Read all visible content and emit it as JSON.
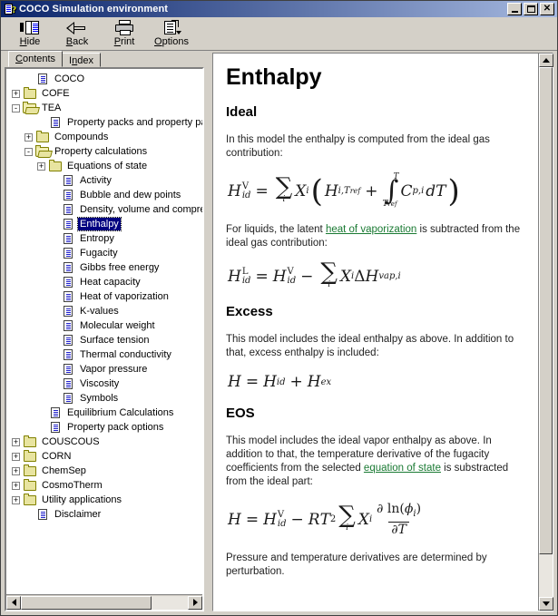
{
  "window": {
    "title": "COCO Simulation environment",
    "icon": "help-book-icon",
    "minimize_label": "_",
    "maximize_label": "□",
    "close_label": "✕"
  },
  "toolbar": {
    "items": [
      {
        "label": "Hide",
        "icon": "hide-pane-icon",
        "accel": "H"
      },
      {
        "label": "Back",
        "icon": "back-arrow-icon",
        "accel": "B"
      },
      {
        "label": "Print",
        "icon": "printer-icon",
        "accel": "P"
      },
      {
        "label": "Options",
        "icon": "options-icon",
        "accel": "O"
      }
    ]
  },
  "tabs": [
    {
      "label": "Contents",
      "accel": "C",
      "active": true
    },
    {
      "label": "Index",
      "accel": "n",
      "active": false
    }
  ],
  "tree": {
    "nodes": [
      {
        "label": "COCO",
        "indent": 1,
        "icon": "topic-page-icon",
        "expander": ""
      },
      {
        "label": "COFE",
        "indent": 0,
        "icon": "folder-closed-icon",
        "expander": "+"
      },
      {
        "label": "TEA",
        "indent": 0,
        "icon": "folder-open-icon",
        "expander": "-"
      },
      {
        "label": "Property packs and property pack i",
        "indent": 2,
        "icon": "topic-page-icon",
        "expander": ""
      },
      {
        "label": "Compounds",
        "indent": 1,
        "icon": "folder-closed-icon",
        "expander": "+"
      },
      {
        "label": "Property calculations",
        "indent": 1,
        "icon": "folder-open-icon",
        "expander": "-"
      },
      {
        "label": "Equations of state",
        "indent": 2,
        "icon": "folder-closed-icon",
        "expander": "+"
      },
      {
        "label": "Activity",
        "indent": 3,
        "icon": "topic-page-icon",
        "expander": ""
      },
      {
        "label": "Bubble and dew points",
        "indent": 3,
        "icon": "topic-page-icon",
        "expander": ""
      },
      {
        "label": "Density, volume and compressi",
        "indent": 3,
        "icon": "topic-page-icon",
        "expander": ""
      },
      {
        "label": "Enthalpy",
        "indent": 3,
        "icon": "topic-page-icon",
        "expander": "",
        "selected": true
      },
      {
        "label": "Entropy",
        "indent": 3,
        "icon": "topic-page-icon",
        "expander": ""
      },
      {
        "label": "Fugacity",
        "indent": 3,
        "icon": "topic-page-icon",
        "expander": ""
      },
      {
        "label": "Gibbs free energy",
        "indent": 3,
        "icon": "topic-page-icon",
        "expander": ""
      },
      {
        "label": "Heat capacity",
        "indent": 3,
        "icon": "topic-page-icon",
        "expander": ""
      },
      {
        "label": "Heat of vaporization",
        "indent": 3,
        "icon": "topic-page-icon",
        "expander": ""
      },
      {
        "label": "K-values",
        "indent": 3,
        "icon": "topic-page-icon",
        "expander": ""
      },
      {
        "label": "Molecular weight",
        "indent": 3,
        "icon": "topic-page-icon",
        "expander": ""
      },
      {
        "label": "Surface tension",
        "indent": 3,
        "icon": "topic-page-icon",
        "expander": ""
      },
      {
        "label": "Thermal conductivity",
        "indent": 3,
        "icon": "topic-page-icon",
        "expander": ""
      },
      {
        "label": "Vapor pressure",
        "indent": 3,
        "icon": "topic-page-icon",
        "expander": ""
      },
      {
        "label": "Viscosity",
        "indent": 3,
        "icon": "topic-page-icon",
        "expander": ""
      },
      {
        "label": "Symbols",
        "indent": 3,
        "icon": "topic-page-icon",
        "expander": ""
      },
      {
        "label": "Equilibrium Calculations",
        "indent": 2,
        "icon": "topic-page-icon",
        "expander": ""
      },
      {
        "label": "Property pack options",
        "indent": 2,
        "icon": "topic-page-icon",
        "expander": ""
      },
      {
        "label": "COUSCOUS",
        "indent": 0,
        "icon": "folder-closed-icon",
        "expander": "+"
      },
      {
        "label": "CORN",
        "indent": 0,
        "icon": "folder-closed-icon",
        "expander": "+"
      },
      {
        "label": "ChemSep",
        "indent": 0,
        "icon": "folder-closed-icon",
        "expander": "+"
      },
      {
        "label": "CosmoTherm",
        "indent": 0,
        "icon": "folder-closed-icon",
        "expander": "+"
      },
      {
        "label": "Utility applications",
        "indent": 0,
        "icon": "folder-closed-icon",
        "expander": "+"
      },
      {
        "label": "Disclaimer",
        "indent": 1,
        "icon": "topic-page-icon",
        "expander": ""
      }
    ]
  },
  "document": {
    "title": "Enthalpy",
    "sections": [
      {
        "heading": "Ideal",
        "para1_a": "In this model the enthalpy is computed from the ideal gas contribution:",
        "para2_a": "For liquids, the latent ",
        "para2_link": "heat of vaporization",
        "para2_b": " is subtracted from the ideal gas contribution:"
      },
      {
        "heading": "Excess",
        "para_a": "This model includes the ideal enthalpy as above. In addition to that, excess enthalpy is included:"
      },
      {
        "heading": "EOS",
        "para_a": "This model includes the ideal vapor enthalpy as above. In addition to that, the temperature derivative of the fugacity coefficients from the selected ",
        "para_link": "equation of state",
        "para_b": " is substracted from the ideal part:"
      }
    ],
    "footer_note": "Pressure and temperature derivatives are determined by perturbation.",
    "equations": {
      "eq1": {
        "latex": "H^V_{id} = \\sum_i X_i \\left( H_{i,T_{ref}} + \\int_{T_{ref}}^{T} C_{p,i} dT \\right)",
        "lhs_var": "H",
        "lhs_sup": "V",
        "lhs_sub": "id",
        "equals": "=",
        "sum_glyph": "∑",
        "sum_index": "i",
        "x_var": "X",
        "x_sub": "i",
        "open_paren": "(",
        "close_paren": ")",
        "h_var": "H",
        "h_sub": "i,T",
        "h_sub_ref": "ref",
        "plus": "+",
        "int_glyph": "∫",
        "int_upper": "T",
        "int_lower": "T",
        "int_lower_sub": "ref",
        "cp_var": "C",
        "cp_sub": "p,i",
        "dT": "dT"
      },
      "eq2": {
        "latex": "H^L_{id} = H^V_{id} - \\sum_i X_i \\Delta H_{vap,i}",
        "lhs_var": "H",
        "lhs_sup": "L",
        "lhs_sub": "id",
        "equals": "=",
        "rhs_var": "H",
        "rhs_sup": "V",
        "rhs_sub": "id",
        "minus": "−",
        "sum_glyph": "∑",
        "sum_index": "i",
        "x_var": "X",
        "x_sub": "i",
        "delta": "Δ",
        "dh_var": "H",
        "dh_sub": "vap,i"
      },
      "eq3": {
        "latex": "H = H_{id} + H_{ex}",
        "lhs_var": "H",
        "equals": "=",
        "t1_var": "H",
        "t1_sub": "id",
        "plus": "+",
        "t2_var": "H",
        "t2_sub": "ex"
      },
      "eq4": {
        "latex": "H = H^V_{id} - RT^2 \\sum_i X_i \\frac{\\partial \\ln(\\phi_i)}{\\partial T}",
        "lhs_var": "H",
        "equals": "=",
        "rhs_var": "H",
        "rhs_sup": "V",
        "rhs_sub": "id",
        "minus": "−",
        "r_var": "R",
        "t_var": "T",
        "t_sup": "2",
        "sum_glyph": "∑",
        "sum_index": "i",
        "x_var": "X",
        "x_sub": "i",
        "frac_num_a": "∂ ln(",
        "frac_num_phi": "ϕ",
        "frac_num_sub": "i",
        "frac_num_b": ")",
        "frac_den_a": "∂",
        "frac_den_t": "T"
      }
    }
  },
  "scrollbars": {
    "tree_left_arrow": "left-arrow",
    "tree_right_arrow": "right-arrow",
    "content_up_arrow": "up-arrow",
    "content_down_arrow": "down-arrow"
  }
}
